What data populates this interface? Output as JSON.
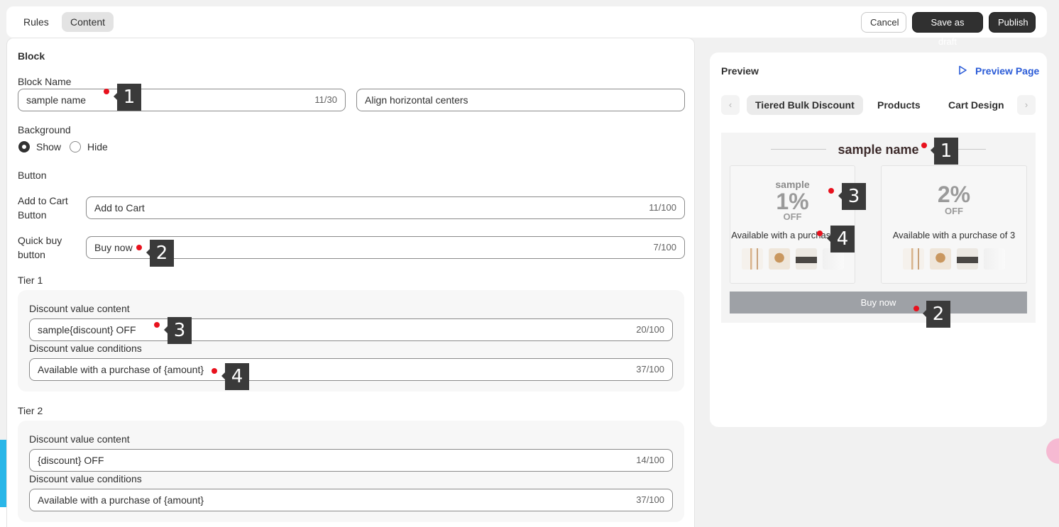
{
  "tabs": {
    "rules": "Rules",
    "content": "Content"
  },
  "actions": {
    "cancel": "Cancel",
    "save_draft": "Save as draft",
    "publish": "Publish"
  },
  "block": {
    "title": "Block",
    "name_label": "Block Name",
    "name_value": "sample name",
    "name_count": "11/30",
    "align_value": "Align horizontal centers",
    "background_label": "Background",
    "bg_show": "Show",
    "bg_hide": "Hide",
    "button_label": "Button",
    "add_to_cart_label": "Add to Cart Button",
    "add_to_cart_label_l1": "Add to Cart",
    "add_to_cart_label_l2": "Button",
    "add_to_cart_value": "Add to Cart",
    "add_to_cart_count": "11/100",
    "quick_buy_label_l1": "Quick buy",
    "quick_buy_label_l2": "button",
    "quick_buy_value": "Buy now",
    "quick_buy_count": "7/100"
  },
  "tiers": [
    {
      "title": "Tier 1",
      "content_label": "Discount value content",
      "content_value": "sample{discount} OFF",
      "content_count": "20/100",
      "cond_label": "Discount value conditions",
      "cond_value": "Available with a purchase of {amount}",
      "cond_count": "37/100"
    },
    {
      "title": "Tier 2",
      "content_label": "Discount value content",
      "content_value": "{discount} OFF",
      "content_count": "14/100",
      "cond_label": "Discount value conditions",
      "cond_value": "Available with a purchase of {amount}",
      "cond_count": "37/100"
    }
  ],
  "preview": {
    "title": "Preview",
    "link": "Preview Page",
    "tabs": [
      "Tiered Bulk Discount",
      "Products",
      "Cart Design"
    ],
    "block_title": "sample name",
    "cards": [
      {
        "prefix": "sample",
        "discount": "1%",
        "off": "OFF",
        "condition": "Available with a purchase of 2"
      },
      {
        "prefix": "",
        "discount": "2%",
        "off": "OFF",
        "condition": "Available with a purchase of 3"
      }
    ],
    "buy_button": "Buy now"
  },
  "markers": [
    "1",
    "2",
    "3",
    "4",
    "1",
    "2",
    "3",
    "4"
  ],
  "colors": {
    "accent_link": "#2a5bd7",
    "marker_dot": "#e8111d",
    "marker_badge": "#3a3a3a",
    "primary_button": "#303030"
  }
}
